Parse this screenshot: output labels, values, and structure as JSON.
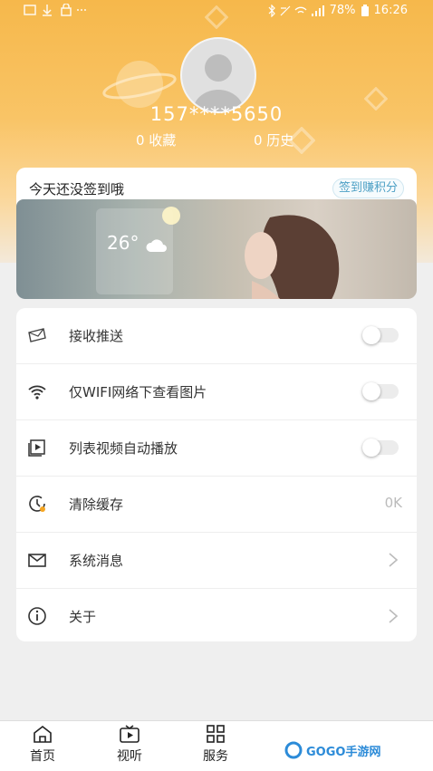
{
  "status_bar": {
    "battery": "78%",
    "time": "16:26"
  },
  "profile": {
    "phone": "157****5650",
    "favorites": "0 收藏",
    "history": "0 历史"
  },
  "sign_in": {
    "title": "今天还没签到哦",
    "button": "签到赚积分",
    "banner_temp": "26°"
  },
  "settings": [
    {
      "icon": "push-icon",
      "label": "接收推送",
      "toggle": false
    },
    {
      "icon": "wifi-icon",
      "label": "仅WIFI网络下查看图片",
      "toggle": false
    },
    {
      "icon": "video-icon",
      "label": "列表视频自动播放",
      "toggle": false
    },
    {
      "icon": "clock-icon",
      "label": "清除缓存",
      "value": "0K"
    },
    {
      "icon": "mail-icon",
      "label": "系统消息"
    },
    {
      "icon": "info-icon",
      "label": "关于"
    }
  ],
  "tabbar": {
    "items": [
      {
        "icon": "home-icon",
        "label": "首页"
      },
      {
        "icon": "video-tab-icon",
        "label": "视听"
      },
      {
        "icon": "grid-icon",
        "label": "服务"
      }
    ]
  },
  "watermark": "GOGO手游网"
}
